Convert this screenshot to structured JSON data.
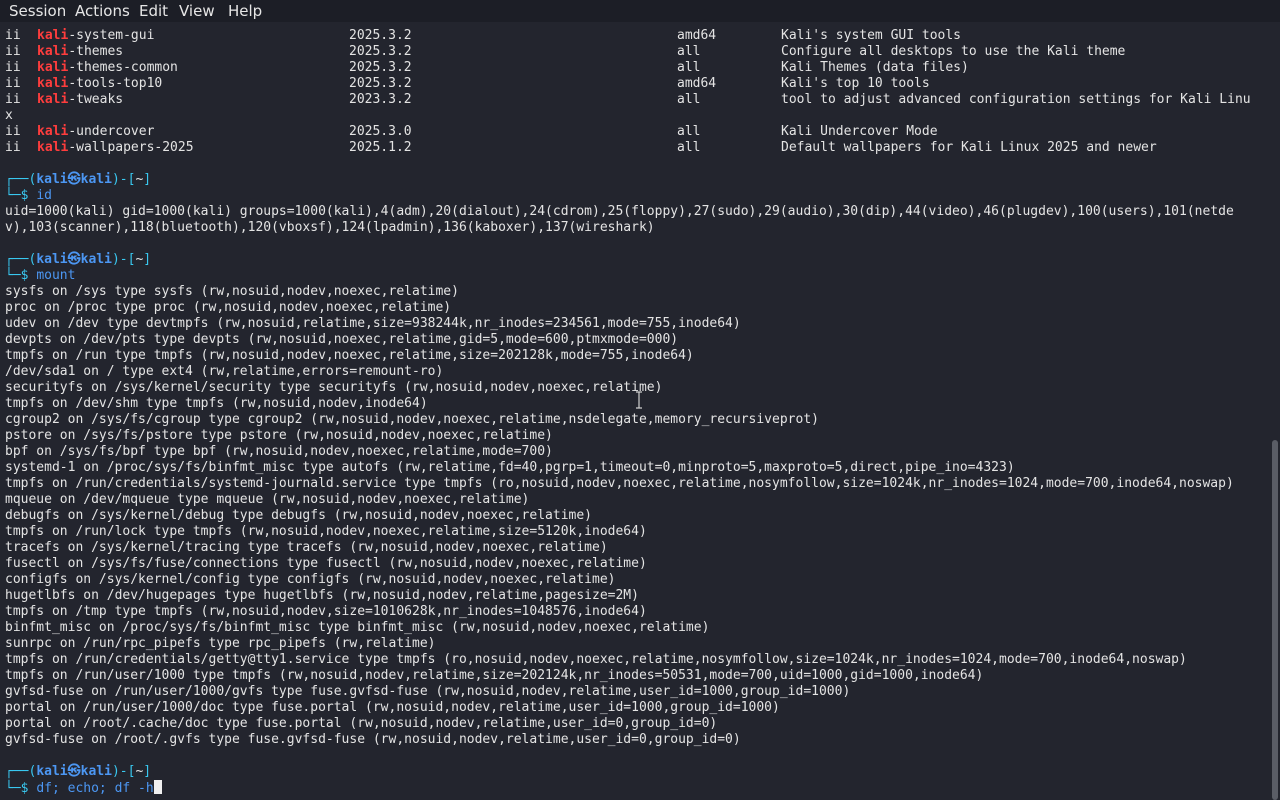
{
  "menu": [
    "Session",
    "Actions",
    "Edit",
    "View",
    "Help"
  ],
  "packages": [
    {
      "status": "ii",
      "prefix": "kali",
      "suffix": "-system-gui",
      "version": "2025.3.2",
      "arch": "amd64",
      "desc": "Kali's system GUI tools"
    },
    {
      "status": "ii",
      "prefix": "kali",
      "suffix": "-themes",
      "version": "2025.3.2",
      "arch": "all",
      "desc": "Configure all desktops to use the Kali theme"
    },
    {
      "status": "ii",
      "prefix": "kali",
      "suffix": "-themes-common",
      "version": "2025.3.2",
      "arch": "all",
      "desc": "Kali Themes (data files)"
    },
    {
      "status": "ii",
      "prefix": "kali",
      "suffix": "-tools-top10",
      "version": "2025.3.2",
      "arch": "amd64",
      "desc": "Kali's top 10 tools"
    },
    {
      "status": "ii",
      "prefix": "kali",
      "suffix": "-tweaks",
      "version": "2023.3.2",
      "arch": "all",
      "desc": "tool to adjust advanced configuration settings for Kali Linu"
    },
    {
      "wrap": "x"
    },
    {
      "status": "ii",
      "prefix": "kali",
      "suffix": "-undercover",
      "version": "2025.3.0",
      "arch": "all",
      "desc": "Kali Undercover Mode"
    },
    {
      "status": "ii",
      "prefix": "kali",
      "suffix": "-wallpapers-2025",
      "version": "2025.1.2",
      "arch": "all",
      "desc": "Default wallpapers for Kali Linux 2025 and newer"
    }
  ],
  "prompt": {
    "user": "kali",
    "at": "㉿",
    "host": "kali",
    "dir": "~",
    "top_open": "┌──(",
    "top_mid": ")-[",
    "top_close": "]",
    "bottom": "└─$"
  },
  "id_cmd": "id",
  "id_output": [
    "uid=1000(kali) gid=1000(kali) groups=1000(kali),4(adm),20(dialout),24(cdrom),25(floppy),27(sudo),29(audio),30(dip),44(video),46(plugdev),100(users),101(netde",
    "v),103(scanner),118(bluetooth),120(vboxsf),124(lpadmin),136(kaboxer),137(wireshark)"
  ],
  "mount_cmd": "mount",
  "mount_output": [
    "sysfs on /sys type sysfs (rw,nosuid,nodev,noexec,relatime)",
    "proc on /proc type proc (rw,nosuid,nodev,noexec,relatime)",
    "udev on /dev type devtmpfs (rw,nosuid,relatime,size=938244k,nr_inodes=234561,mode=755,inode64)",
    "devpts on /dev/pts type devpts (rw,nosuid,noexec,relatime,gid=5,mode=600,ptmxmode=000)",
    "tmpfs on /run type tmpfs (rw,nosuid,nodev,noexec,relatime,size=202128k,mode=755,inode64)",
    "/dev/sda1 on / type ext4 (rw,relatime,errors=remount-ro)",
    "securityfs on /sys/kernel/security type securityfs (rw,nosuid,nodev,noexec,relatime)",
    "tmpfs on /dev/shm type tmpfs (rw,nosuid,nodev,inode64)",
    "cgroup2 on /sys/fs/cgroup type cgroup2 (rw,nosuid,nodev,noexec,relatime,nsdelegate,memory_recursiveprot)",
    "pstore on /sys/fs/pstore type pstore (rw,nosuid,nodev,noexec,relatime)",
    "bpf on /sys/fs/bpf type bpf (rw,nosuid,nodev,noexec,relatime,mode=700)",
    "systemd-1 on /proc/sys/fs/binfmt_misc type autofs (rw,relatime,fd=40,pgrp=1,timeout=0,minproto=5,maxproto=5,direct,pipe_ino=4323)",
    "tmpfs on /run/credentials/systemd-journald.service type tmpfs (ro,nosuid,nodev,noexec,relatime,nosymfollow,size=1024k,nr_inodes=1024,mode=700,inode64,noswap)",
    "mqueue on /dev/mqueue type mqueue (rw,nosuid,nodev,noexec,relatime)",
    "debugfs on /sys/kernel/debug type debugfs (rw,nosuid,nodev,noexec,relatime)",
    "tmpfs on /run/lock type tmpfs (rw,nosuid,nodev,noexec,relatime,size=5120k,inode64)",
    "tracefs on /sys/kernel/tracing type tracefs (rw,nosuid,nodev,noexec,relatime)",
    "fusectl on /sys/fs/fuse/connections type fusectl (rw,nosuid,nodev,noexec,relatime)",
    "configfs on /sys/kernel/config type configfs (rw,nosuid,nodev,noexec,relatime)",
    "hugetlbfs on /dev/hugepages type hugetlbfs (rw,nosuid,nodev,relatime,pagesize=2M)",
    "tmpfs on /tmp type tmpfs (rw,nosuid,nodev,size=1010628k,nr_inodes=1048576,inode64)",
    "binfmt_misc on /proc/sys/fs/binfmt_misc type binfmt_misc (rw,nosuid,nodev,noexec,relatime)",
    "sunrpc on /run/rpc_pipefs type rpc_pipefs (rw,relatime)",
    "tmpfs on /run/credentials/getty@tty1.service type tmpfs (ro,nosuid,nodev,noexec,relatime,nosymfollow,size=1024k,nr_inodes=1024,mode=700,inode64,noswap)",
    "tmpfs on /run/user/1000 type tmpfs (rw,nosuid,nodev,relatime,size=202124k,nr_inodes=50531,mode=700,uid=1000,gid=1000,inode64)",
    "gvfsd-fuse on /run/user/1000/gvfs type fuse.gvfsd-fuse (rw,nosuid,nodev,relatime,user_id=1000,group_id=1000)",
    "portal on /run/user/1000/doc type fuse.portal (rw,nosuid,nodev,relatime,user_id=1000,group_id=1000)",
    "portal on /root/.cache/doc type fuse.portal (rw,nosuid,nodev,relatime,user_id=0,group_id=0)",
    "gvfsd-fuse on /root/.gvfs type fuse.gvfsd-fuse (rw,nosuid,nodev,relatime,user_id=0,group_id=0)"
  ],
  "current_input": "df; echo; df -h"
}
